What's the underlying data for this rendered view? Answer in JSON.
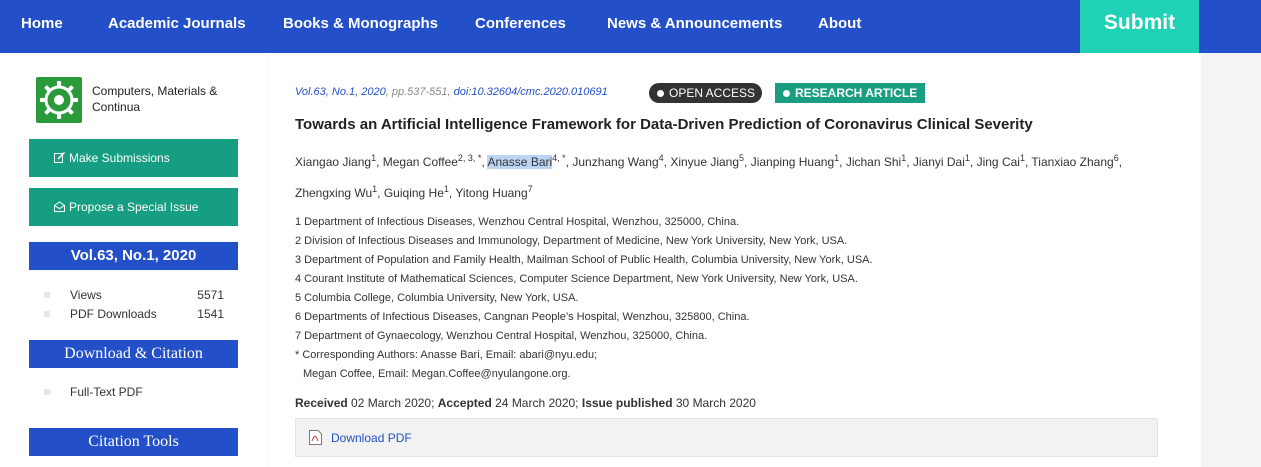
{
  "nav": {
    "items": [
      "Home",
      "Academic Journals",
      "Books & Monographs",
      "Conferences",
      "News & Announcements",
      "About"
    ],
    "submit_label": "Submit"
  },
  "sidebar": {
    "journal_name": "Computers, Materials & Continua",
    "make_submissions": "Make Submissions",
    "propose_special_issue": "Propose a Special Issue",
    "volume": "Vol.63, No.1, 2020",
    "stats": [
      {
        "label": "Views",
        "value": "5571"
      },
      {
        "label": "PDF Downloads",
        "value": "1541"
      }
    ],
    "download_citation_heading": "Download & Citation",
    "full_text_pdf": "Full-Text PDF",
    "citation_tools_heading": "Citation Tools"
  },
  "article": {
    "meta_volume": "Vol.63, No.1, 2020",
    "meta_pages": "pp.537-551,",
    "meta_doi": "doi:10.32604/cmc.2020.010691",
    "badge_open": "OPEN ACCESS",
    "badge_type": "RESEARCH ARTICLE",
    "title": "Towards an Artificial Intelligence Framework for Data-Driven Prediction of Coronavirus Clinical Severity",
    "authors_line1": [
      {
        "name": "Xiangao Jiang",
        "sup": "1"
      },
      {
        "name": "Megan Coffee",
        "sup": "2, 3, *"
      },
      {
        "name": "Anasse Bari",
        "sup": "4, *"
      },
      {
        "name": "Junzhang Wang",
        "sup": "4"
      },
      {
        "name": "Xinyue Jiang",
        "sup": "5"
      },
      {
        "name": "Jianping Huang",
        "sup": "1"
      },
      {
        "name": "Jichan Shi",
        "sup": "1"
      },
      {
        "name": "Jianyi Dai",
        "sup": "1"
      },
      {
        "name": "Jing Cai",
        "sup": "1"
      },
      {
        "name": "Tianxiao Zhang",
        "sup": "6"
      }
    ],
    "authors_line2": [
      {
        "name": "Zhengxing Wu",
        "sup": "1"
      },
      {
        "name": "Guiqing He",
        "sup": "1"
      },
      {
        "name": "Yitong Huang",
        "sup": "7"
      }
    ],
    "affiliations": [
      "1 Department of Infectious Diseases, Wenzhou Central Hospital, Wenzhou, 325000, China.",
      "2 Division of Infectious Diseases and Immunology, Department of Medicine, New York University, New York, USA.",
      "3 Department of Population and Family Health, Mailman School of Public Health, Columbia University, New York, USA.",
      "4 Courant Institute of Mathematical Sciences, Computer Science Department, New York University, New York, USA.",
      "5 Columbia College, Columbia University, New York, USA.",
      "6 Departments of Infectious Diseases, Cangnan People’s Hospital, Wenzhou, 325800, China.",
      "7 Department of Gynaecology, Wenzhou Central Hospital, Wenzhou, 325000, China."
    ],
    "corresponding_1": "* Corresponding Authors: Anasse Bari, Email: abari@nyu.edu;",
    "corresponding_2": "Megan Coffee, Email: Megan.Coffee@nyulangone.org.",
    "received_label": "Received",
    "received_date": " 02 March 2020; ",
    "accepted_label": "Accepted",
    "accepted_date": " 24 March 2020; ",
    "published_label": "Issue published",
    "published_date": " 30 March 2020",
    "download_pdf": "Download PDF"
  },
  "colors": {
    "nav_blue": "#2350c8",
    "submit_teal": "#1fd1b5",
    "button_green": "#159e82"
  }
}
